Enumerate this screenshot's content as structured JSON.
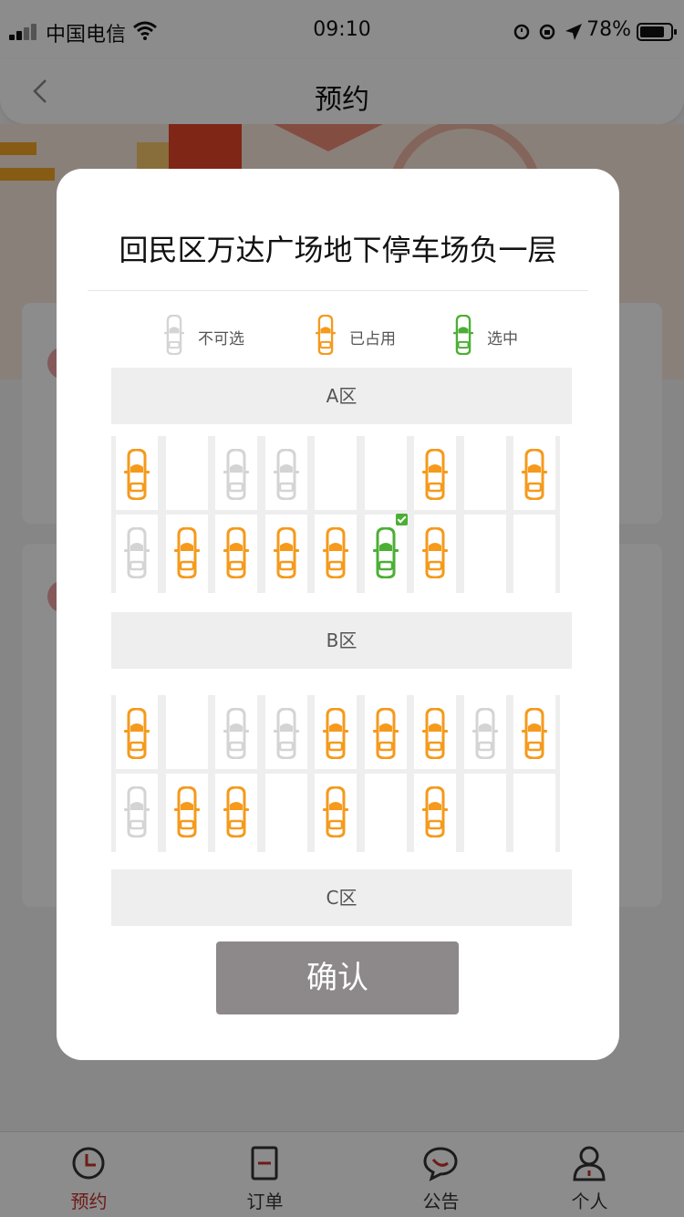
{
  "status_bar": {
    "carrier": "中国电信",
    "time": "09:10",
    "battery": "78%"
  },
  "nav": {
    "title": "预约"
  },
  "modal": {
    "title": "回民区万达广场地下停车场负一层",
    "legend": [
      {
        "label": "不可选",
        "status": "unavailable"
      },
      {
        "label": "已占用",
        "status": "occupied"
      },
      {
        "label": "选中",
        "status": "selected"
      }
    ],
    "zones": [
      {
        "name": "A区",
        "rows": [
          [
            "occupied",
            "empty",
            "unavailable",
            "unavailable",
            "empty",
            "empty",
            "occupied",
            "empty",
            "occupied"
          ],
          [
            "unavailable",
            "occupied",
            "occupied",
            "occupied",
            "occupied",
            "selected",
            "occupied",
            "empty",
            "empty"
          ]
        ]
      },
      {
        "name": "B区",
        "rows": [
          [
            "occupied",
            "empty",
            "unavailable",
            "unavailable",
            "occupied",
            "occupied",
            "occupied",
            "unavailable",
            "occupied"
          ],
          [
            "unavailable",
            "occupied",
            "occupied",
            "empty",
            "occupied",
            "empty",
            "occupied",
            "empty",
            "empty"
          ]
        ]
      },
      {
        "name": "C区",
        "rows": []
      }
    ],
    "confirm_label": "确认"
  },
  "colors": {
    "unavailable": "#d4d4d4",
    "occupied": "#f59a1c",
    "selected": "#4caf35",
    "accent": "#c8322c"
  },
  "tabbar": {
    "items": [
      {
        "label": "预约",
        "icon": "clock-icon",
        "active": true
      },
      {
        "label": "订单",
        "icon": "order-icon",
        "active": false
      },
      {
        "label": "公告",
        "icon": "chat-bubble-icon",
        "active": false
      },
      {
        "label": "个人",
        "icon": "person-icon",
        "active": false
      }
    ]
  }
}
